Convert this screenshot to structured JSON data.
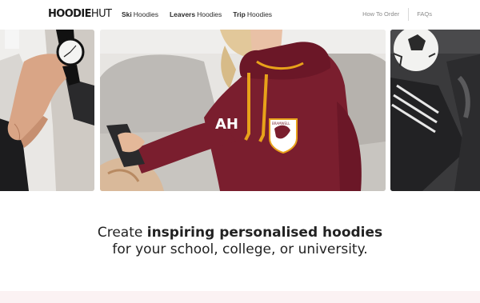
{
  "brand": {
    "logo_bold": "HOODIE",
    "logo_light": "HUT"
  },
  "nav": {
    "items": [
      {
        "bold": "Ski",
        "label": "Hoodies"
      },
      {
        "bold": "Leavers",
        "label": "Hoodies"
      },
      {
        "bold": "Trip",
        "label": "Hoodies"
      }
    ],
    "how_to_order": "How To Order",
    "faqs": "FAQs"
  },
  "hero": {
    "hoodie_initials": "AH",
    "crest_text": "BRAMWELL"
  },
  "headline": {
    "prefix": "Create",
    "emphasis": "inspiring personalised hoodies",
    "line2": "for your school, college, or university."
  },
  "colors": {
    "hoodie": "#7a1e2e",
    "drawstring": "#e8a21a",
    "sofa": "#c9c6c2",
    "band": "#fbf2f3"
  },
  "icons": {
    "left_slide": "watch-photo",
    "right_slide": "football-photo"
  }
}
